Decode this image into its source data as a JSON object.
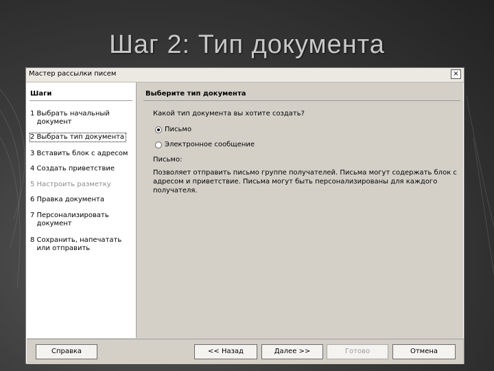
{
  "slide": {
    "title": "Шаг 2: Тип документа"
  },
  "dialog": {
    "title": "Мастер рассылки писем",
    "close_glyph": "×",
    "steps": {
      "header": "Шаги",
      "items": [
        {
          "label": "1 Выбрать начальный\n   документ"
        },
        {
          "label": "2 Выбрать тип документа"
        },
        {
          "label": "3 Вставить блок с адресом"
        },
        {
          "label": "4 Создать приветствие"
        },
        {
          "label": "5 Настроить разметку"
        },
        {
          "label": "6 Правка документа"
        },
        {
          "label": "7 Персонализировать\n   документ"
        },
        {
          "label": "8 Сохранить, напечатать\n   или отправить"
        }
      ],
      "selected_index": 1,
      "disabled_index": 4
    },
    "content": {
      "header": "Выберите тип документа",
      "question": "Какой тип документа вы хотите создать?",
      "options": [
        {
          "label": "Письмо",
          "checked": true
        },
        {
          "label": "Электронное сообщение",
          "checked": false
        }
      ],
      "description_title": "Письмо:",
      "description_text": "Позволяет отправить письмо группе получателей. Письма могут содержать блок с адресом и приветствие. Письма могут быть персонализированы для каждого получателя."
    },
    "buttons": {
      "help": "Справка",
      "back": "<< Назад",
      "next": "Далее >>",
      "finish": "Готово",
      "cancel": "Отмена"
    }
  }
}
